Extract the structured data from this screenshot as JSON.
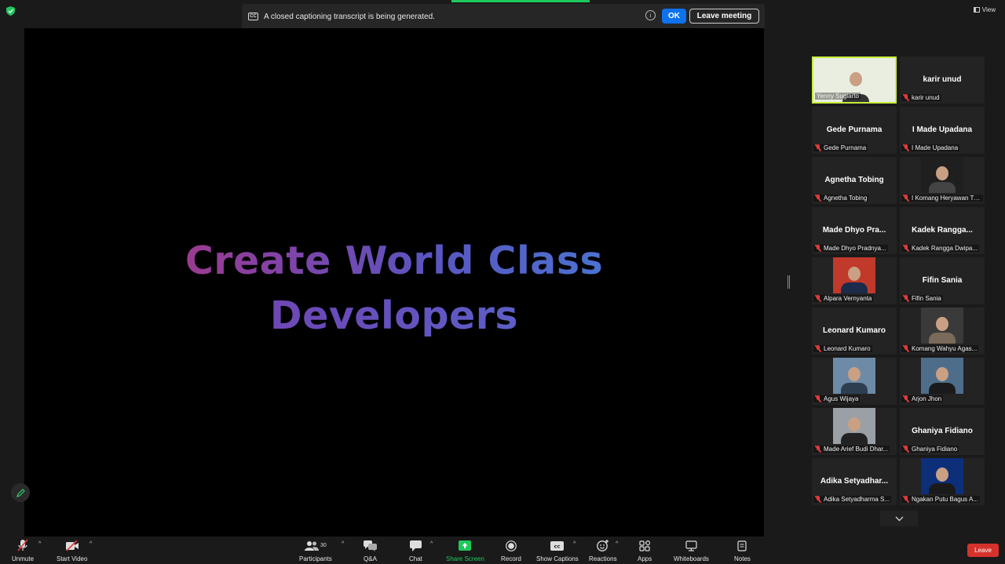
{
  "caption_banner": {
    "cc_label": "CC",
    "message": "A closed captioning transcript is being generated.",
    "info_label": "i",
    "ok_label": "OK",
    "leave_meeting_label": "Leave meeting"
  },
  "view_label": "View",
  "slide": {
    "line1": "Create World Class",
    "line2": "Developers"
  },
  "gallery": [
    {
      "display": "",
      "label": "Yenny Sugiarto",
      "video": true,
      "active": true
    },
    {
      "display": "karir unud",
      "label": "karir unud",
      "video": false
    },
    {
      "display": "Gede Purnama",
      "label": "Gede Purnama",
      "video": false
    },
    {
      "display": "I Made Upadana",
      "label": "I Made Upadana",
      "video": false
    },
    {
      "display": "Agnetha Tobing",
      "label": "Agnetha Tobing",
      "video": false
    },
    {
      "display": "",
      "label": "I Komang Heryawan Tril...",
      "video": true
    },
    {
      "display": "Made  Dhyo  Pra...",
      "label": "Made Dhyo Pradnya...",
      "video": false
    },
    {
      "display": "Kadek  Rangga...",
      "label": "Kadek Rangga Dwipa...",
      "video": false
    },
    {
      "display": "",
      "label": "Alpara Vernyanta",
      "video": true
    },
    {
      "display": "Fifin Sania",
      "label": "Fifin Sania",
      "video": false
    },
    {
      "display": "Leonard Kumaro",
      "label": "Leonard Kumaro",
      "video": false
    },
    {
      "display": "",
      "label": "Komang Wahyu Agas...",
      "video": true
    },
    {
      "display": "",
      "label": "Agus Wijaya",
      "video": true
    },
    {
      "display": "",
      "label": "Arjon Jhon",
      "video": true
    },
    {
      "display": "",
      "label": "Made Arief Budi Dhar...",
      "video": true
    },
    {
      "display": "Ghaniya Fidiano",
      "label": "Ghaniya Fidiano",
      "video": false
    },
    {
      "display": "Adika  Setyadhar...",
      "label": "Adika Setyadharma S...",
      "video": false
    },
    {
      "display": "",
      "label": "Ngakan Putu Bagus A...",
      "video": true
    }
  ],
  "toolbar": {
    "unmute": "Unmute",
    "start_video": "Start Video",
    "participants": "Participants",
    "participants_count": "30",
    "qa": "Q&A",
    "chat": "Chat",
    "share_screen": "Share Screen",
    "record": "Record",
    "show_captions": "Show Captions",
    "reactions": "Reactions",
    "apps": "Apps",
    "whiteboards": "Whiteboards",
    "notes": "Notes",
    "leave": "Leave"
  },
  "colors": {
    "share_green": "#1ec95b",
    "ok_blue": "#0e72ed",
    "leave_red": "#d6322c",
    "active_speaker": "#c9ee3a",
    "muted_red": "#e23b3b"
  },
  "icons": [
    "shield-icon",
    "closed-caption-icon",
    "info-icon",
    "view-icon",
    "pencil-icon",
    "chevron-down-icon",
    "microphone-muted-icon",
    "video-off-icon",
    "participants-icon",
    "qa-icon",
    "chat-icon",
    "share-screen-icon",
    "record-icon",
    "captions-icon",
    "reactions-icon",
    "apps-icon",
    "whiteboard-icon",
    "notes-icon"
  ]
}
